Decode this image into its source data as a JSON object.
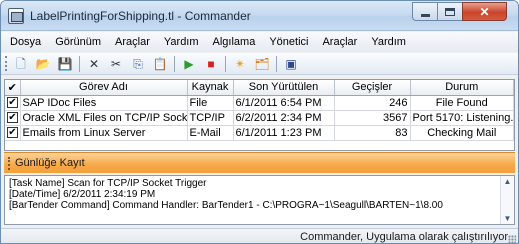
{
  "window": {
    "title": "LabelPrintingForShipping.tl - Commander",
    "close_glyph": "✕"
  },
  "menu": [
    "Dosya",
    "Görünüm",
    "Araçlar",
    "Yardım",
    "Algılama",
    "Yönetici",
    "Araçlar",
    "Yardım"
  ],
  "toolbar": {
    "icons": [
      {
        "name": "new-icon",
        "glyph": "🗋",
        "color": "#4a6fa5"
      },
      {
        "name": "open-icon",
        "glyph": "📂",
        "color": "#d9a521"
      },
      {
        "name": "save-icon",
        "glyph": "💾",
        "color": "#2e5b9a"
      },
      {
        "name": "delete-icon",
        "glyph": "✕",
        "color": "#333333"
      },
      {
        "name": "cut-icon",
        "glyph": "✂",
        "color": "#333333"
      },
      {
        "name": "copy-icon",
        "glyph": "⎘",
        "color": "#4a6fa5"
      },
      {
        "name": "paste-icon",
        "glyph": "📋",
        "color": "#a3743a"
      },
      {
        "name": "start-icon",
        "glyph": "▶",
        "color": "#2e9b2e"
      },
      {
        "name": "stop-icon",
        "glyph": "■",
        "color": "#d42424"
      },
      {
        "name": "wizard-icon",
        "glyph": "✴",
        "color": "#e3a020"
      },
      {
        "name": "properties-icon",
        "glyph": "🗂",
        "color": "#d27b1c"
      },
      {
        "name": "printer-icon",
        "glyph": "▣",
        "color": "#2e4a8a"
      }
    ]
  },
  "grid": {
    "columns": [
      "✔",
      "Görev Adı",
      "Kaynak",
      "Son Yürütülen",
      "Geçişler",
      "Durum"
    ],
    "rows": [
      {
        "checked": "✔",
        "name": "SAP IDoc Files",
        "source": "File",
        "last_run": "6/1/2011 6:54 PM",
        "passes": "246",
        "status": "File Found"
      },
      {
        "checked": "✔",
        "name": "Oracle XML Files on TCP/IP Socket",
        "source": "TCP/IP",
        "last_run": "6/2/2011 2:34 PM",
        "passes": "3567",
        "status": "Port 5170: Listening..."
      },
      {
        "checked": "✔",
        "name": "Emails from Linux Server",
        "source": "E-Mail",
        "last_run": "6/1/2011 1:23 PM",
        "passes": "83",
        "status": "Checking Mail"
      }
    ]
  },
  "log": {
    "title": "Günlüğe Kayıt",
    "lines": [
      "[Task Name] Scan for TCP/IP Socket Trigger",
      "[Date/Time] 6/2/2011 2:34:19 PM",
      "[BarTender Command] Command Handler: BarTender1 - C:\\PROGRA~1\\Seagull\\BARTEN~1\\8.00"
    ],
    "scroll_up": "▲",
    "scroll_down": "▼"
  },
  "status": {
    "text": "Commander, Uygulama olarak çalıştırılıyor"
  }
}
